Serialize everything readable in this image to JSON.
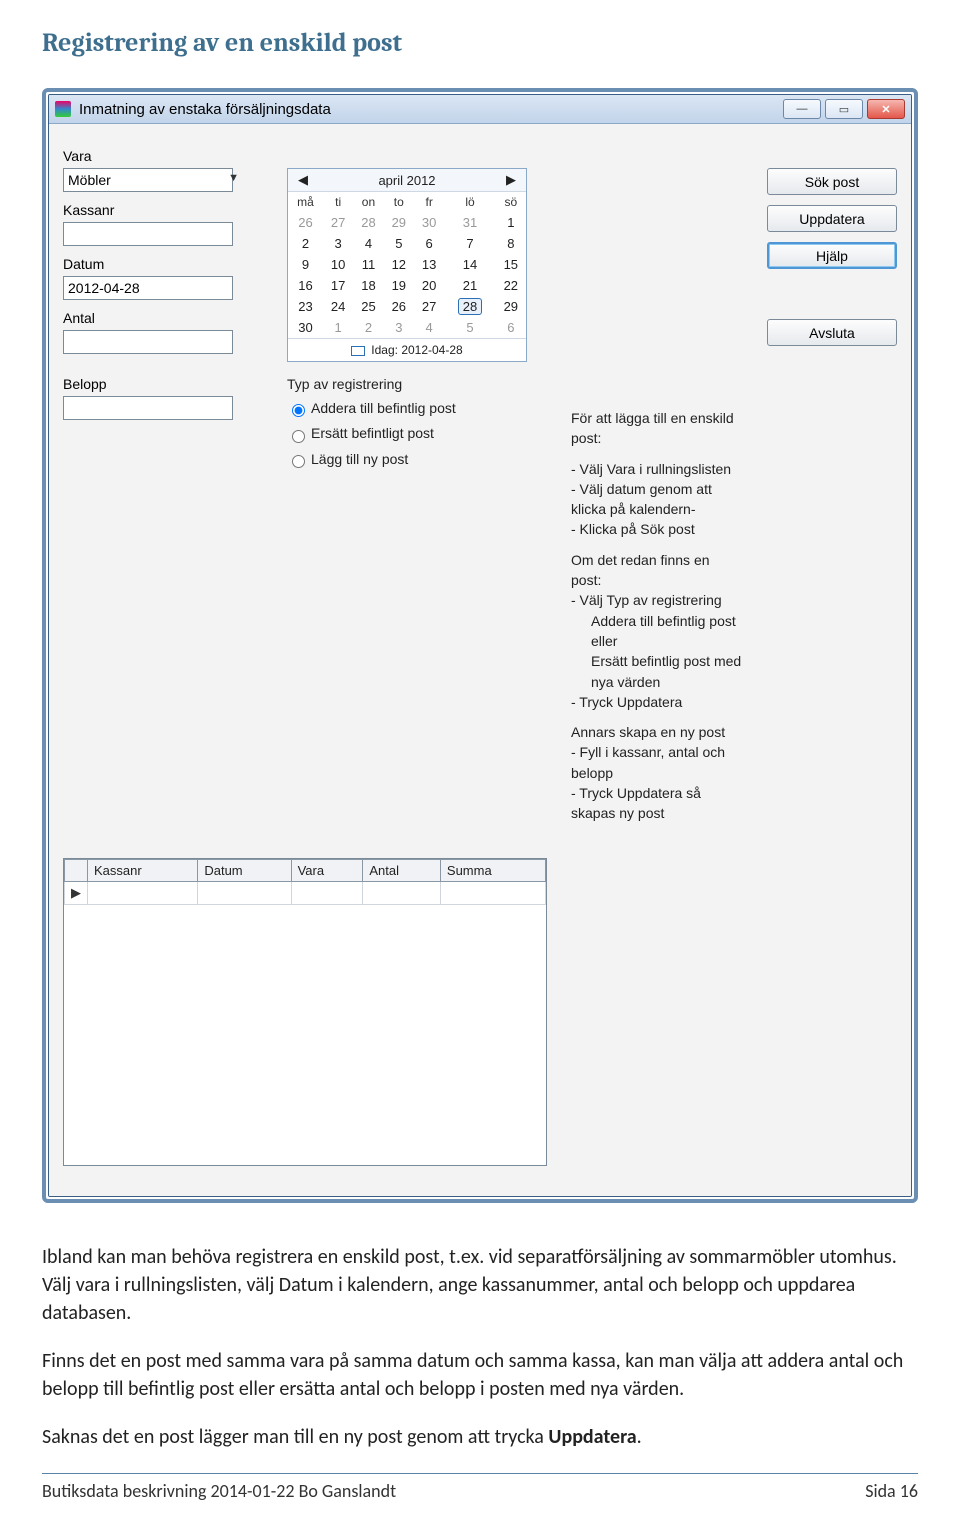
{
  "doc": {
    "heading": "Registrering av en enskild post",
    "para1": "Ibland kan man behöva registrera en enskild post, t.ex. vid separatförsäljning av sommarmöbler utomhus. Välj vara i rullningslisten, välj Datum i kalendern, ange kassanummer, antal och belopp och uppdarea databasen.",
    "para2": "Finns det en post med samma vara på samma datum och samma kassa, kan man välja att addera antal och belopp till befintlig post eller ersätta antal och belopp i posten med nya värden.",
    "para3_a": "Saknas det en post lägger man till en ny post genom att trycka ",
    "para3_b": "Uppdatera",
    "para3_c": ".",
    "footer_left": "Butiksdata beskrivning 2014-01-22 Bo Ganslandt",
    "footer_right": "Sida 16"
  },
  "window": {
    "title": "Inmatning av enstaka försäljningsdata",
    "labels": {
      "vara": "Vara",
      "kassanr": "Kassanr",
      "datum": "Datum",
      "antal": "Antal",
      "belopp": "Belopp"
    },
    "fields": {
      "vara_value": "Möbler",
      "kassanr_value": "",
      "datum_value": "2012-04-28",
      "antal_value": "",
      "belopp_value": ""
    },
    "buttons": {
      "sok": "Sök post",
      "uppdatera": "Uppdatera",
      "hjalp": "Hjälp",
      "avsluta": "Avsluta"
    },
    "regtype": {
      "head": "Typ av registrering",
      "opt1": "Addera till befintlig post",
      "opt2": "Ersätt befintligt post",
      "opt3": "Lägg till ny post"
    },
    "table": {
      "cols": [
        "Kassanr",
        "Datum",
        "Vara",
        "Antal",
        "Summa"
      ]
    },
    "help": {
      "l0": "För att lägga till en enskild post:",
      "l1": "- Välj Vara i rullningslisten",
      "l2": "- Välj datum genom att klicka på kalendern-",
      "l3": "- Klicka på Sök post",
      "l4": "Om det redan finns en post:",
      "l5": "-  Välj Typ av registrering",
      "l5a": "Addera till befintlig post eller",
      "l5b": "Ersätt befintlig post med nya värden",
      "l6": "-  Tryck Uppdatera",
      "l7": "Annars skapa en ny post",
      "l8": "-  Fyll i kassanr, antal och belopp",
      "l9": "-  Tryck Uppdatera så skapas ny post"
    }
  },
  "calendar": {
    "title": "april 2012",
    "weekdays": [
      "må",
      "ti",
      "on",
      "to",
      "fr",
      "lö",
      "sö"
    ],
    "weeks": [
      [
        {
          "d": "26",
          "out": true
        },
        {
          "d": "27",
          "out": true
        },
        {
          "d": "28",
          "out": true
        },
        {
          "d": "29",
          "out": true
        },
        {
          "d": "30",
          "out": true
        },
        {
          "d": "31",
          "out": true
        },
        {
          "d": "1"
        }
      ],
      [
        {
          "d": "2"
        },
        {
          "d": "3"
        },
        {
          "d": "4"
        },
        {
          "d": "5"
        },
        {
          "d": "6"
        },
        {
          "d": "7"
        },
        {
          "d": "8"
        }
      ],
      [
        {
          "d": "9"
        },
        {
          "d": "10"
        },
        {
          "d": "11"
        },
        {
          "d": "12"
        },
        {
          "d": "13"
        },
        {
          "d": "14"
        },
        {
          "d": "15"
        }
      ],
      [
        {
          "d": "16"
        },
        {
          "d": "17"
        },
        {
          "d": "18"
        },
        {
          "d": "19"
        },
        {
          "d": "20"
        },
        {
          "d": "21"
        },
        {
          "d": "22"
        }
      ],
      [
        {
          "d": "23"
        },
        {
          "d": "24"
        },
        {
          "d": "25"
        },
        {
          "d": "26"
        },
        {
          "d": "27"
        },
        {
          "d": "28",
          "sel": true
        },
        {
          "d": "29"
        }
      ],
      [
        {
          "d": "30"
        },
        {
          "d": "1",
          "out": true
        },
        {
          "d": "2",
          "out": true
        },
        {
          "d": "3",
          "out": true
        },
        {
          "d": "4",
          "out": true
        },
        {
          "d": "5",
          "out": true
        },
        {
          "d": "6",
          "out": true
        }
      ]
    ],
    "today": "Idag: 2012-04-28"
  }
}
